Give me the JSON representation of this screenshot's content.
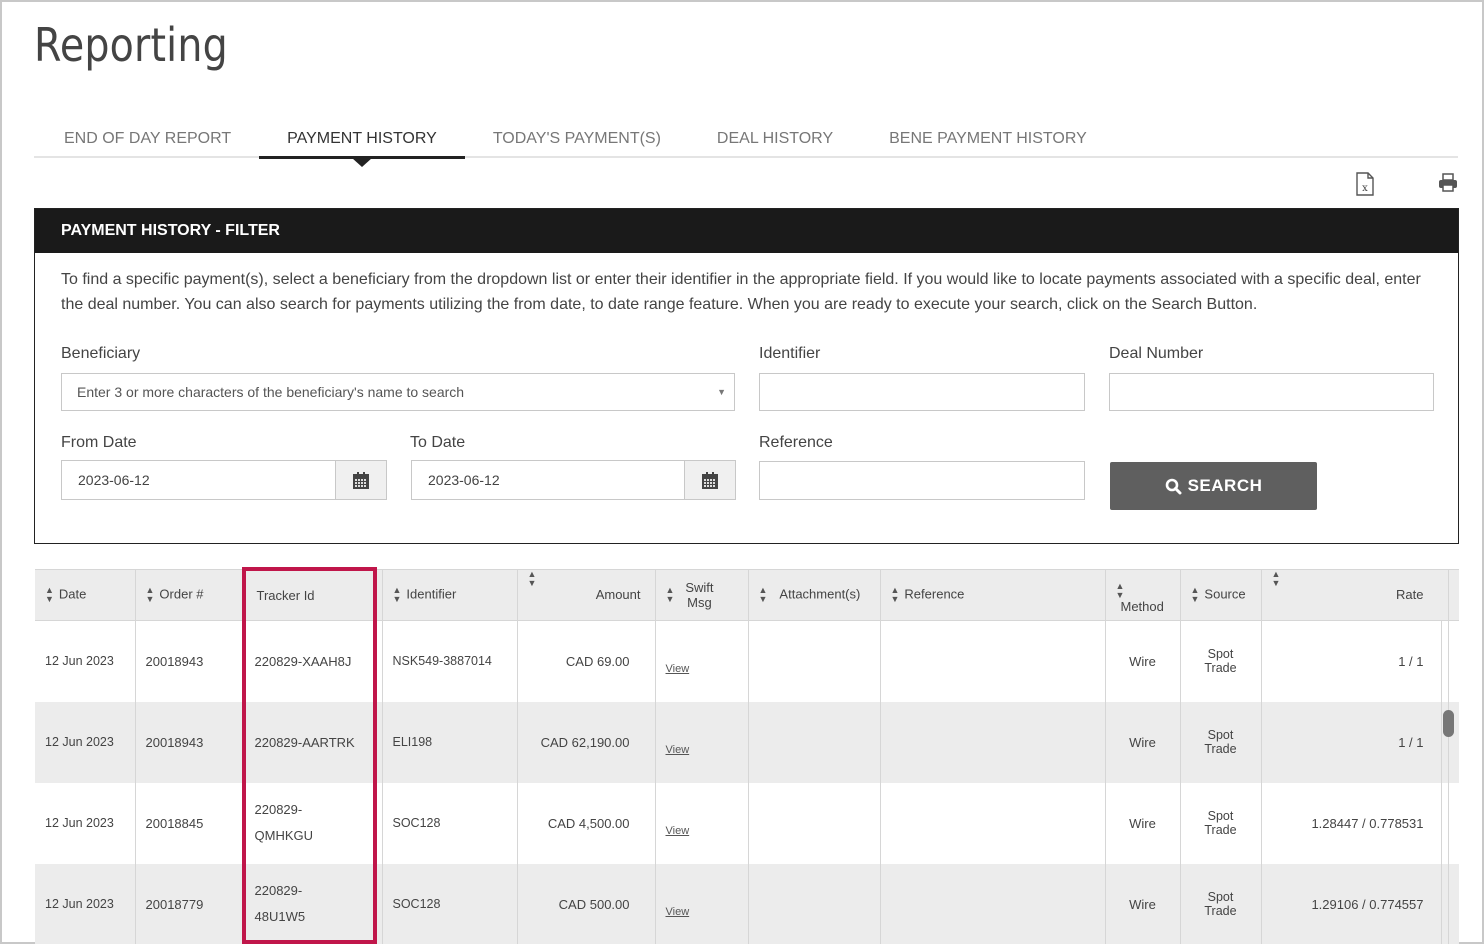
{
  "page": {
    "title": "Reporting"
  },
  "tabs": [
    {
      "label": "END OF DAY REPORT",
      "active": false
    },
    {
      "label": "PAYMENT HISTORY",
      "active": true
    },
    {
      "label": "TODAY'S PAYMENT(S)",
      "active": false
    },
    {
      "label": "DEAL HISTORY",
      "active": false
    },
    {
      "label": "BENE PAYMENT HISTORY",
      "active": false
    }
  ],
  "toolbar": {
    "export_icon": "excel-export-icon",
    "print_icon": "print-icon"
  },
  "filter": {
    "title": "PAYMENT HISTORY - FILTER",
    "description": "To find a specific payment(s), select a beneficiary from the dropdown list or enter their identifier in the appropriate field. If you would like to locate payments associated with a specific deal, enter the deal number. You can also search for payments utilizing the from date, to date range feature. When you are ready to execute your search, click on the Search Button.",
    "beneficiary": {
      "label": "Beneficiary",
      "placeholder": "Enter 3 or more characters of the beneficiary's name to search"
    },
    "identifier": {
      "label": "Identifier",
      "value": ""
    },
    "deal_number": {
      "label": "Deal Number",
      "value": ""
    },
    "from_date": {
      "label": "From Date",
      "value": "2023-06-12"
    },
    "to_date": {
      "label": "To Date",
      "value": "2023-06-12"
    },
    "reference": {
      "label": "Reference",
      "value": ""
    },
    "search_label": "SEARCH"
  },
  "table": {
    "columns": [
      "Date",
      "Order #",
      "Tracker Id",
      "Identifier",
      "Amount",
      "Swift Msg",
      "Attachment(s)",
      "Reference",
      "Method",
      "Source",
      "Rate"
    ],
    "view_label": "View",
    "rows": [
      {
        "date": "12 Jun 2023",
        "order": "20018943",
        "tracker": "220829-XAAH8J",
        "identifier": "NSK549-3887014",
        "amount": "CAD 69.00",
        "attachments": "",
        "reference": "",
        "method": "Wire",
        "source": "Spot Trade",
        "rate": "1 / 1"
      },
      {
        "date": "12 Jun 2023",
        "order": "20018943",
        "tracker": "220829-AARTRK",
        "identifier": "ELI198",
        "amount": "CAD 62,190.00",
        "attachments": "",
        "reference": "",
        "method": "Wire",
        "source": "Spot Trade",
        "rate": "1 / 1"
      },
      {
        "date": "12 Jun 2023",
        "order": "20018845",
        "tracker": "220829-QMHKGU",
        "identifier": "SOC128",
        "amount": "CAD 4,500.00",
        "attachments": "",
        "reference": "",
        "method": "Wire",
        "source": "Spot Trade",
        "rate": "1.28447 / 0.778531"
      },
      {
        "date": "12 Jun 2023",
        "order": "20018779",
        "tracker": "220829-48U1W5",
        "identifier": "SOC128",
        "amount": "CAD 500.00",
        "attachments": "",
        "reference": "",
        "method": "Wire",
        "source": "Spot Trade",
        "rate": "1.29106 / 0.774557"
      }
    ]
  },
  "colors": {
    "highlight": "#c0164a",
    "header_bg": "#1a1a1a",
    "button_bg": "#5f5f5f"
  }
}
